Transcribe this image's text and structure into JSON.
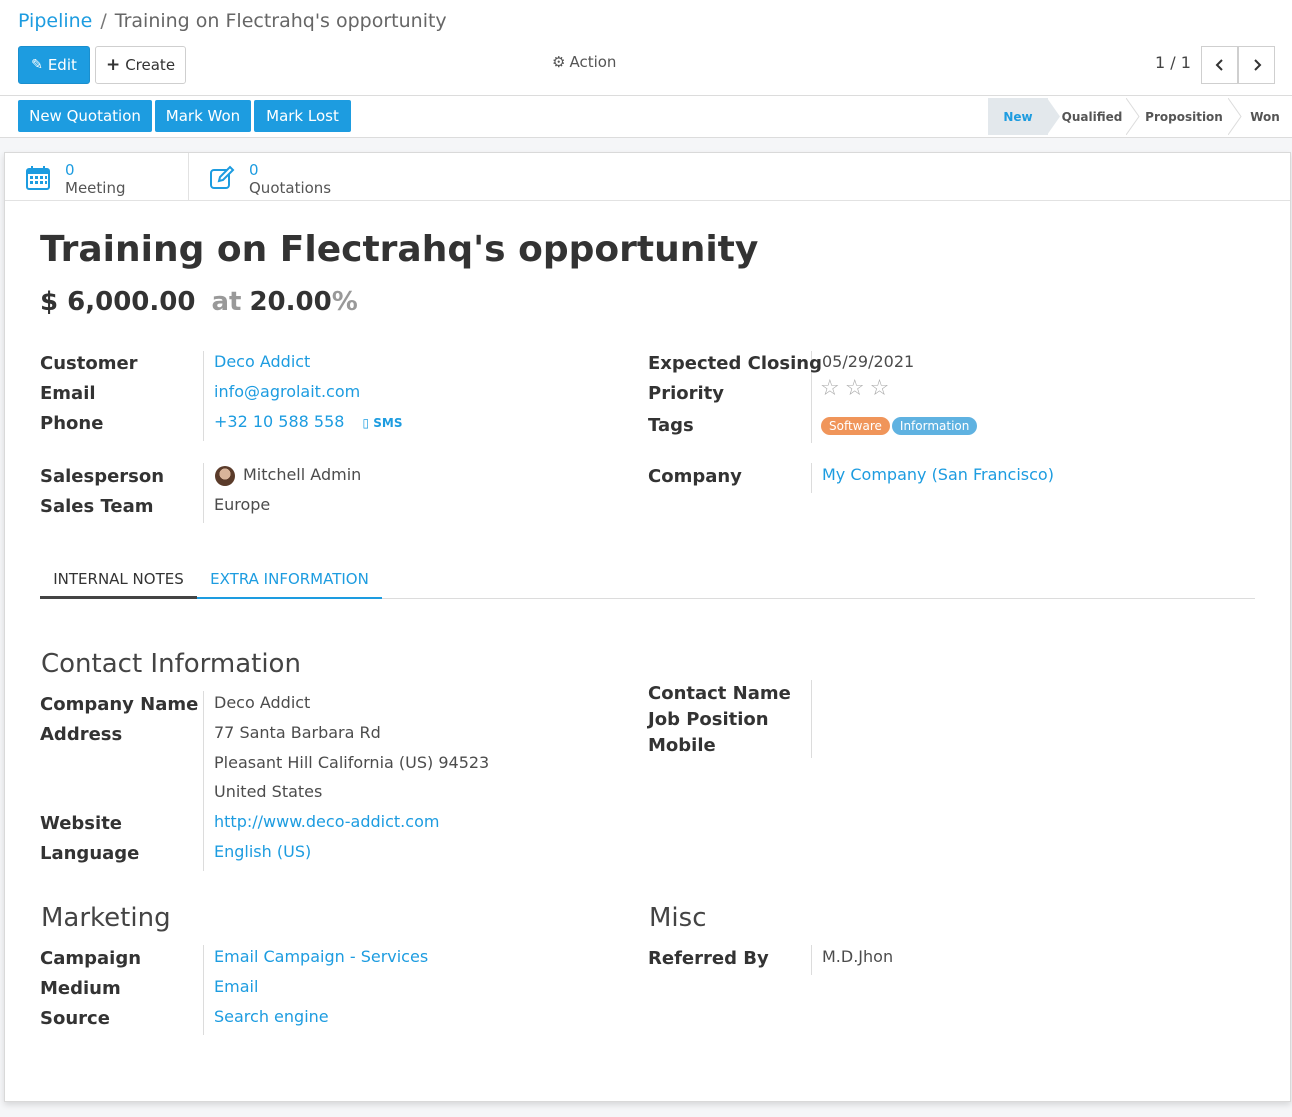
{
  "breadcrumb": {
    "parent": "Pipeline",
    "separator": "/",
    "current": "Training on Flectrahq's opportunity"
  },
  "toolbar": {
    "edit_label": "Edit",
    "create_label": "Create",
    "action_label": "Action",
    "pager": "1 / 1"
  },
  "statusbar": {
    "buttons": [
      "New Quotation",
      "Mark Won",
      "Mark Lost"
    ],
    "stages": [
      "New",
      "Qualified",
      "Proposition",
      "Won"
    ],
    "active_stage": "New"
  },
  "smart_buttons": [
    {
      "count": "0",
      "label": "Meeting",
      "icon": "calendar-icon"
    },
    {
      "count": "0",
      "label": "Quotations",
      "icon": "edit-icon"
    }
  ],
  "record": {
    "title": "Training on Flectrahq's opportunity",
    "revenue": "$ 6,000.00",
    "at": "at",
    "probability": "20.00",
    "percent": "%"
  },
  "fields": {
    "customer_label": "Customer",
    "customer": "Deco Addict",
    "email_label": "Email",
    "email": "info@agrolait.com",
    "phone_label": "Phone",
    "phone": "+32 10 588 558",
    "sms": "SMS",
    "salesperson_label": "Salesperson",
    "salesperson": "Mitchell Admin",
    "team_label": "Sales Team",
    "team": "Europe",
    "closing_label": "Expected Closing",
    "closing": "05/29/2021",
    "priority_label": "Priority",
    "priority_stars": 0,
    "tags_label": "Tags",
    "tags": [
      "Software",
      "Information"
    ],
    "company_label": "Company",
    "company": "My Company (San Francisco)"
  },
  "colors": {
    "accent": "#1d9ce0",
    "tag_software": "#f0955a",
    "tag_information": "#5fb2e1"
  },
  "tabs": [
    {
      "label": "INTERNAL NOTES",
      "active": false
    },
    {
      "label": "EXTRA INFORMATION",
      "active": true
    }
  ],
  "contact": {
    "title": "Contact Information",
    "company_name_label": "Company Name",
    "company_name": "Deco Addict",
    "address_label": "Address",
    "address_line1": "77 Santa Barbara Rd",
    "address_line2": "Pleasant Hill  California (US)  94523",
    "address_line3": "United States",
    "website_label": "Website",
    "website": "http://www.deco-addict.com",
    "language_label": "Language",
    "language": "English (US)",
    "contact_name_label": "Contact Name",
    "job_position_label": "Job Position",
    "mobile_label": "Mobile"
  },
  "marketing": {
    "title": "Marketing",
    "campaign_label": "Campaign",
    "campaign": "Email Campaign - Services",
    "medium_label": "Medium",
    "medium": "Email",
    "source_label": "Source",
    "source": "Search engine"
  },
  "misc": {
    "title": "Misc",
    "referred_label": "Referred By",
    "referred": "M.D.Jhon"
  }
}
